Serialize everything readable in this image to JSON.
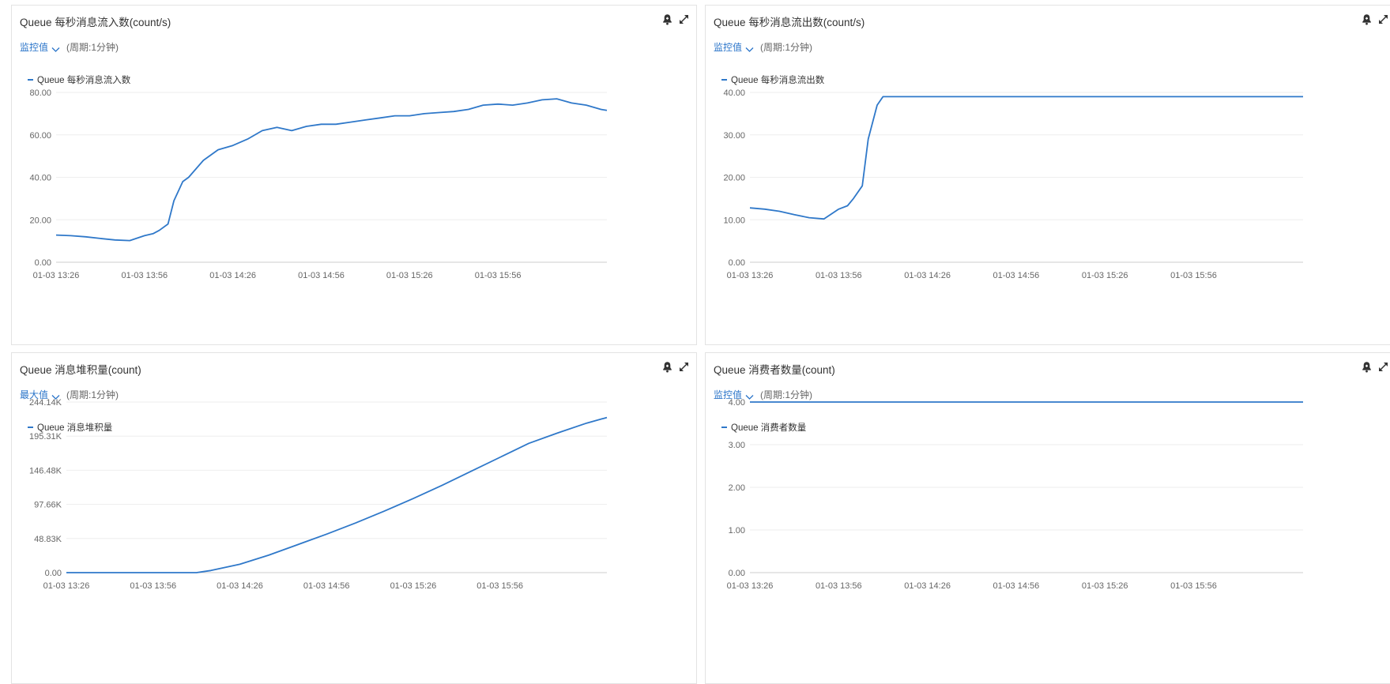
{
  "colors": {
    "series": "#2f78c9",
    "link": "#2a74c9",
    "grid": "#eeeeee",
    "axis": "#cccccc"
  },
  "icons": {
    "alarm": "bell-plus-icon",
    "expand": "expand-arrows-icon"
  },
  "panels": [
    {
      "title": "Queue 每秒消息流入数(count/s)",
      "metric_label": "监控值",
      "period": "(周期:1分钟)",
      "legend": "Queue 每秒消息流入数"
    },
    {
      "title": "Queue 每秒消息流出数(count/s)",
      "metric_label": "监控值",
      "period": "(周期:1分钟)",
      "legend": "Queue 每秒消息流出数"
    },
    {
      "title": "Queue 消息堆积量(count)",
      "metric_label": "最大值",
      "period": "(周期:1分钟)",
      "legend": "Queue 消息堆积量"
    },
    {
      "title": "Queue 消费者数量(count)",
      "metric_label": "监控值",
      "period": "(周期:1分钟)",
      "legend": "Queue 消费者数量"
    }
  ],
  "chart_data": [
    {
      "type": "line",
      "title": "Queue 每秒消息流入数(count/s)",
      "x_ticks": [
        "01-03 13:26",
        "01-03 13:56",
        "01-03 14:26",
        "01-03 14:56",
        "01-03 15:26",
        "01-03 15:56"
      ],
      "y_ticks": [
        "0.00",
        "20.00",
        "40.00",
        "60.00",
        "80.00"
      ],
      "ylim": [
        0,
        80
      ],
      "x_range": [
        "01-03 13:26",
        "01-03 16:33"
      ],
      "grid": true,
      "legend_position": "top-left",
      "series": [
        {
          "name": "Queue 每秒消息流入数",
          "x": [
            "01-03 13:26",
            "01-03 13:31",
            "01-03 13:36",
            "01-03 13:41",
            "01-03 13:46",
            "01-03 13:51",
            "01-03 13:56",
            "01-03 13:59",
            "01-03 14:01",
            "01-03 14:04",
            "01-03 14:06",
            "01-03 14:09",
            "01-03 14:11",
            "01-03 14:16",
            "01-03 14:21",
            "01-03 14:26",
            "01-03 14:31",
            "01-03 14:36",
            "01-03 14:41",
            "01-03 14:46",
            "01-03 14:51",
            "01-03 14:56",
            "01-03 15:01",
            "01-03 15:06",
            "01-03 15:11",
            "01-03 15:16",
            "01-03 15:21",
            "01-03 15:26",
            "01-03 15:31",
            "01-03 15:36",
            "01-03 15:41",
            "01-03 15:46",
            "01-03 15:51",
            "01-03 15:56",
            "01-03 16:01",
            "01-03 16:06",
            "01-03 16:11",
            "01-03 16:16",
            "01-03 16:21",
            "01-03 16:26",
            "01-03 16:31",
            "01-03 16:33"
          ],
          "values": [
            12.8,
            12.5,
            12,
            11.2,
            10.5,
            10.2,
            12.5,
            13.5,
            15,
            18,
            29,
            38,
            40,
            48,
            53,
            55,
            58,
            62,
            63.5,
            62,
            64,
            65,
            65,
            66,
            67,
            68,
            69,
            69,
            70,
            70.5,
            71,
            72,
            74,
            74.5,
            74,
            75,
            76.5,
            77,
            75,
            74,
            72,
            71.5
          ]
        }
      ]
    },
    {
      "type": "line",
      "title": "Queue 每秒消息流出数(count/s)",
      "x_ticks": [
        "01-03 13:26",
        "01-03 13:56",
        "01-03 14:26",
        "01-03 14:56",
        "01-03 15:26",
        "01-03 15:56"
      ],
      "y_ticks": [
        "0.00",
        "10.00",
        "20.00",
        "30.00",
        "40.00"
      ],
      "ylim": [
        0,
        40
      ],
      "x_range": [
        "01-03 13:26",
        "01-03 16:33"
      ],
      "grid": true,
      "legend_position": "top-left",
      "series": [
        {
          "name": "Queue 每秒消息流出数",
          "x": [
            "01-03 13:26",
            "01-03 13:31",
            "01-03 13:36",
            "01-03 13:41",
            "01-03 13:46",
            "01-03 13:51",
            "01-03 13:56",
            "01-03 13:59",
            "01-03 14:01",
            "01-03 14:04",
            "01-03 14:06",
            "01-03 14:09",
            "01-03 14:11",
            "01-03 14:16",
            "01-03 14:26",
            "01-03 14:56",
            "01-03 15:26",
            "01-03 15:56",
            "01-03 16:33"
          ],
          "values": [
            12.8,
            12.5,
            12,
            11.2,
            10.5,
            10.2,
            12.5,
            13.3,
            15,
            18,
            29,
            37,
            39,
            39,
            39,
            39,
            39,
            39,
            39
          ]
        }
      ]
    },
    {
      "type": "line",
      "title": "Queue 消息堆积量(count)",
      "x_ticks": [
        "01-03 13:26",
        "01-03 13:56",
        "01-03 14:26",
        "01-03 14:56",
        "01-03 15:26",
        "01-03 15:56"
      ],
      "y_ticks": [
        "0.00",
        "48.83K",
        "97.66K",
        "146.48K",
        "195.31K",
        "244.14K"
      ],
      "ylim": [
        0,
        244140
      ],
      "x_range": [
        "01-03 13:26",
        "01-03 16:33"
      ],
      "grid": true,
      "legend_position": "top-left",
      "series": [
        {
          "name": "Queue 消息堆积量",
          "x": [
            "01-03 13:26",
            "01-03 13:56",
            "01-03 14:11",
            "01-03 14:16",
            "01-03 14:26",
            "01-03 14:36",
            "01-03 14:46",
            "01-03 14:56",
            "01-03 15:06",
            "01-03 15:16",
            "01-03 15:26",
            "01-03 15:36",
            "01-03 15:46",
            "01-03 15:56",
            "01-03 16:06",
            "01-03 16:16",
            "01-03 16:26",
            "01-03 16:33"
          ],
          "values": [
            0,
            0,
            0,
            3000,
            12000,
            25000,
            40000,
            55000,
            71000,
            88000,
            106000,
            125000,
            145000,
            165000,
            185000,
            200000,
            214000,
            222000
          ]
        }
      ]
    },
    {
      "type": "line",
      "title": "Queue 消费者数量(count)",
      "x_ticks": [
        "01-03 13:26",
        "01-03 13:56",
        "01-03 14:26",
        "01-03 14:56",
        "01-03 15:26",
        "01-03 15:56"
      ],
      "y_ticks": [
        "0.00",
        "1.00",
        "2.00",
        "3.00",
        "4.00"
      ],
      "ylim": [
        0,
        4
      ],
      "x_range": [
        "01-03 13:26",
        "01-03 16:33"
      ],
      "grid": true,
      "legend_position": "top-left",
      "series": [
        {
          "name": "Queue 消费者数量",
          "x": [
            "01-03 13:26",
            "01-03 16:33"
          ],
          "values": [
            4,
            4
          ]
        }
      ]
    }
  ]
}
